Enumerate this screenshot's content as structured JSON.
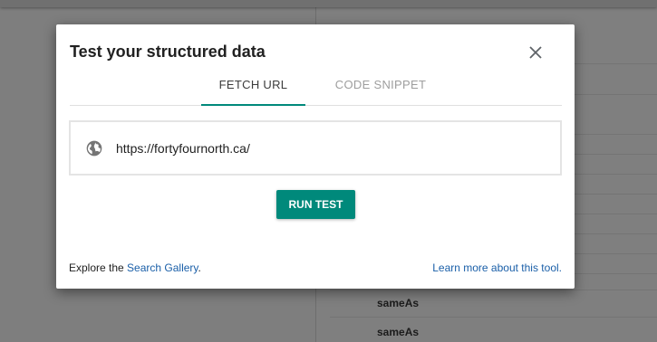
{
  "background": {
    "rows": [
      "sameAs",
      "sameAs"
    ]
  },
  "dialog": {
    "title": "Test your structured data",
    "tabs": [
      {
        "label": "FETCH URL",
        "active": true
      },
      {
        "label": "CODE SNIPPET",
        "active": false
      }
    ],
    "url_value": "https://fortyfournorth.ca/",
    "run_button": "RUN TEST",
    "footer": {
      "explore_prefix": "Explore the ",
      "search_gallery": "Search Gallery",
      "explore_suffix": ".",
      "learn_more": "Learn more about this tool."
    }
  },
  "colors": {
    "accent": "#00897b",
    "link": "#1a5fa8"
  },
  "icons": {
    "close": "close-icon",
    "globe": "globe-icon"
  }
}
